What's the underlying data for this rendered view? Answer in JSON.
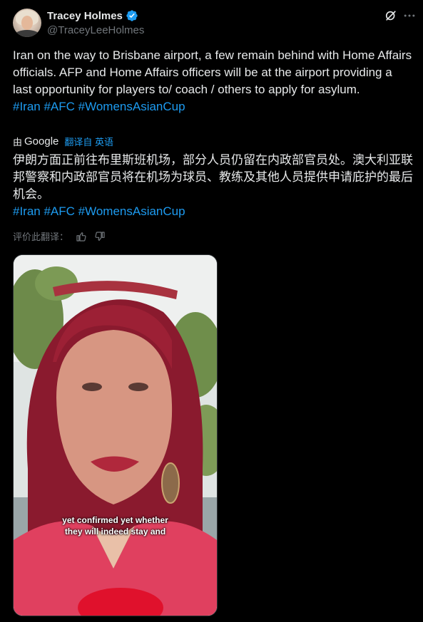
{
  "author": {
    "display_name": "Tracey Holmes",
    "handle": "@TraceyLeeHolmes",
    "verified": true
  },
  "icons": {
    "verified": "verified-badge-icon",
    "grok": "grok-icon",
    "more": "more-icon",
    "thumbs_up": "thumbs-up-icon",
    "thumbs_down": "thumbs-down-icon"
  },
  "tweet": {
    "text": "Iran on the way to Brisbane airport, a few remain behind with Home Affairs officials. AFP and Home Affairs officers will be at the airport providing a last opportunity for players to/ coach / others to apply for asylum.",
    "hashtags": "#Iran #AFC #WomensAsianCup"
  },
  "translation": {
    "by_label": "由",
    "provider": "Google",
    "link_label": "翻译自 英语",
    "text": "伊朗方面正前往布里斯班机场，部分人员仍留在内政部官员处。澳大利亚联邦警察和内政部官员将在机场为球员、教练及其他人员提供申请庇护的最后机会。",
    "hashtags": "#Iran #AFC #WomensAsianCup",
    "rate_label": "评价此翻译："
  },
  "video": {
    "caption_line1": "yet confirmed yet whether",
    "caption_line2": "they will indeed stay and"
  },
  "colors": {
    "background": "#000000",
    "text": "#e7e9ea",
    "secondary": "#71767b",
    "accent": "#1d9bf0"
  }
}
